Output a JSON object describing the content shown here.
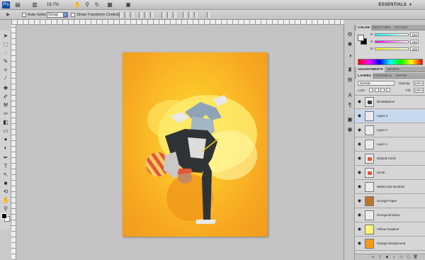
{
  "appbar": {
    "logo": "Ps",
    "zoom": "16.7%",
    "workspace": "ESSENTIALS",
    "icons": [
      "bridge-icon",
      "minibridge-icon",
      "zoom-level-icon",
      "hand-icon",
      "zoom-icon",
      "rotate-icon",
      "grid-icon",
      "screen-mode-icon"
    ]
  },
  "options": {
    "auto_select_label": "Auto-Select:",
    "auto_select_target": "Group",
    "show_transform_label": "Show Transform Controls"
  },
  "tools": [
    "move-tool-icon",
    "marquee-tool-icon",
    "lasso-tool-icon",
    "quick-select-tool-icon",
    "crop-tool-icon",
    "eyedropper-tool-icon",
    "healing-brush-tool-icon",
    "brush-tool-icon",
    "clone-stamp-tool-icon",
    "history-brush-tool-icon",
    "eraser-tool-icon",
    "gradient-tool-icon",
    "blur-tool-icon",
    "dodge-tool-icon",
    "pen-tool-icon",
    "type-tool-icon",
    "path-select-tool-icon",
    "shape-tool-icon",
    "3d-rotate-tool-icon",
    "3d-camera-tool-icon",
    "hand-tool-icon",
    "zoom-tool-icon"
  ],
  "dock_icons": [
    "color-panel-icon",
    "swatches-panel-icon",
    "styles-panel-icon",
    "adjustments-panel-icon",
    "masks-panel-icon",
    "layers-panel-icon",
    "channels-panel-icon",
    "paths-panel-icon"
  ],
  "color_panel": {
    "tabs": [
      "COLOR",
      "SWATCHES",
      "STYLES"
    ],
    "sliders": [
      {
        "label": "R",
        "value": "255",
        "color": "#ff0000"
      },
      {
        "label": "G",
        "value": "255",
        "color": "#00c000"
      },
      {
        "label": "B",
        "value": "255",
        "color": "#0000ff"
      }
    ]
  },
  "adjust_panel": {
    "tabs": [
      "ADJUSTMENTS",
      "MASKS"
    ]
  },
  "layers_panel": {
    "tabs": [
      "LAYERS",
      "CHANNELS",
      "PATHS"
    ],
    "blend_mode": "Normal",
    "opacity_label": "Opacity:",
    "opacity_value": "100%",
    "lock_label": "Lock:",
    "fill_label": "Fill:",
    "fill_value": "100%",
    "layers": [
      {
        "name": "Breakdancer",
        "selected": false,
        "thumb": "dancer"
      },
      {
        "name": "Layer 3",
        "selected": true,
        "thumb": "empty"
      },
      {
        "name": "Layer 2",
        "selected": false,
        "thumb": "empty"
      },
      {
        "name": "Layer 1",
        "selected": false,
        "thumb": "empty"
      },
      {
        "name": "Striped Circle",
        "selected": false,
        "thumb": "dot"
      },
      {
        "name": "Circle",
        "selected": false,
        "thumb": "dot"
      },
      {
        "name": "Watercolor Brushes",
        "selected": false,
        "thumb": "empty"
      },
      {
        "name": "Grunge Paper",
        "selected": false,
        "thumb": "paper"
      },
      {
        "name": "Grunge Brushes",
        "selected": false,
        "thumb": "empty"
      },
      {
        "name": "Yellow Gradient",
        "selected": false,
        "thumb": "yellow"
      },
      {
        "name": "Orange Background",
        "selected": false,
        "thumb": "orange"
      }
    ],
    "footer_icons": [
      "link-layers-icon",
      "layer-style-icon",
      "layer-mask-icon",
      "adjustment-layer-icon",
      "new-group-icon",
      "new-layer-icon",
      "delete-layer-icon"
    ]
  },
  "colors": {
    "accent_selected": "#c7d8ef",
    "doc_orange": "#f29a1c",
    "doc_yellow": "#ffe23c"
  }
}
